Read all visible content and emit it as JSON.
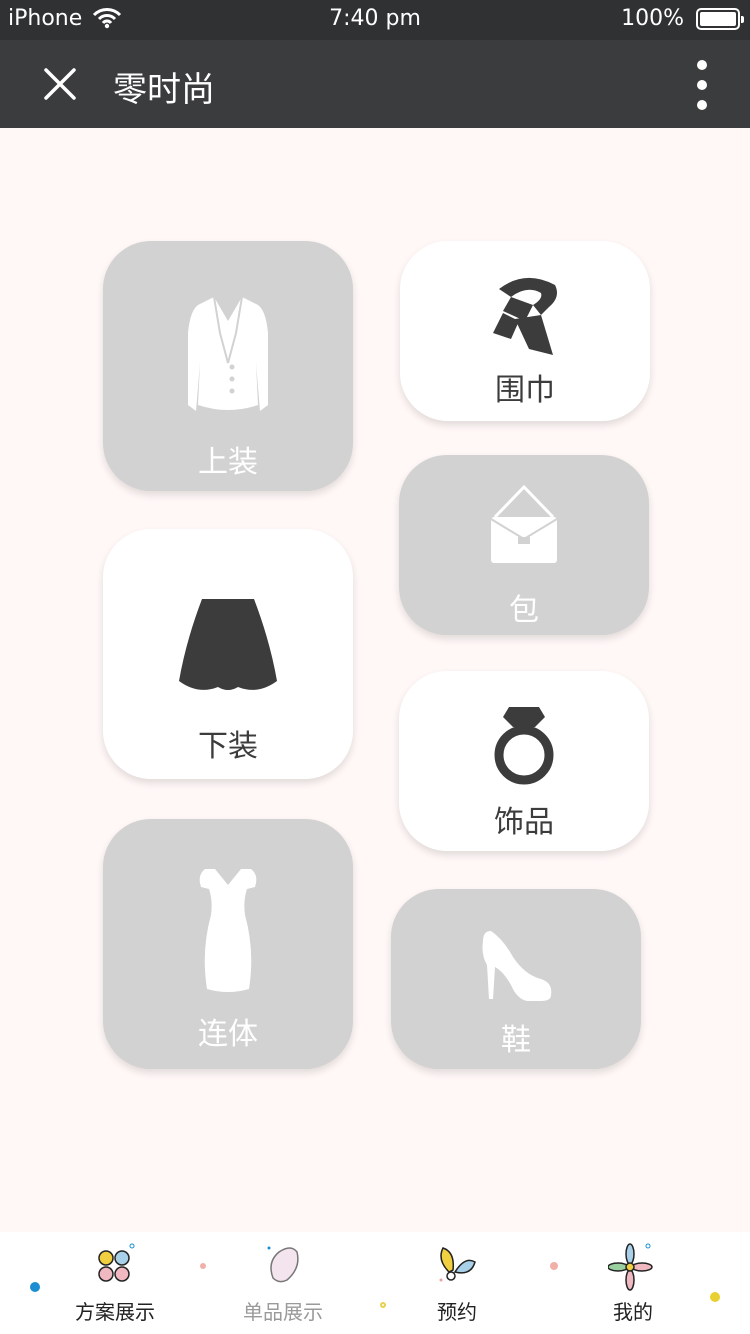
{
  "status_bar": {
    "carrier": "iPhone",
    "time": "7:40 pm",
    "battery": "100%"
  },
  "nav": {
    "title": "零时尚"
  },
  "categories": {
    "tops": {
      "label": "上装",
      "icon": "jacket-icon"
    },
    "scarf": {
      "label": "围巾",
      "icon": "scarf-icon"
    },
    "bag": {
      "label": "包",
      "icon": "bag-icon"
    },
    "bottoms": {
      "label": "下装",
      "icon": "skirt-icon"
    },
    "accessories": {
      "label": "饰品",
      "icon": "ring-icon"
    },
    "dress": {
      "label": "连体",
      "icon": "dress-icon"
    },
    "shoes": {
      "label": "鞋",
      "icon": "high-heel-icon"
    }
  },
  "tabs": [
    {
      "label": "方案展示",
      "icon": "four-petal-icon",
      "active": true
    },
    {
      "label": "单品展示",
      "icon": "petal-icon",
      "active": false
    },
    {
      "label": "预约",
      "icon": "leaves-icon",
      "active": true
    },
    {
      "label": "我的",
      "icon": "flower-icon",
      "active": true
    }
  ],
  "colors": {
    "background": "#fff8f7",
    "tile_gray": "#d2d2d2",
    "tile_white": "#ffffff",
    "navbar": "#3a3c3e",
    "icon_dark": "#3c3c3c"
  }
}
